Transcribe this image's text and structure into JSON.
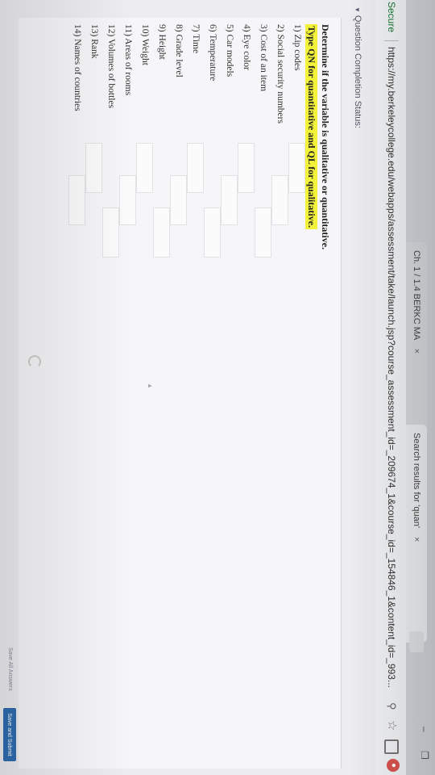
{
  "browser": {
    "tabs": [
      {
        "label": "Ch. 1 / 1.4 BERKC MA",
        "close": "×"
      },
      {
        "label": "Search results for 'quan'",
        "close": "×"
      }
    ],
    "secure_label": "Secure",
    "url": "https://my.berkeleycollege.edu/webapps/assessment/take/launch.jsp?course_assessment_id=_209674_1&course_id=_154846_1&content_id=_993..."
  },
  "page": {
    "completion_status": "Question Completion Status:",
    "instruction_line1": "Determine if the variable is qualitative or quantitative.",
    "instruction_line2": "Type QN for quantitative and QL for qualitative.",
    "items": [
      {
        "label": "1) Zip codes"
      },
      {
        "label": "2) Social security numbers"
      },
      {
        "label": "3) Cost of an item"
      },
      {
        "label": "4) Eye color"
      },
      {
        "label": "5) Car models"
      },
      {
        "label": "6) Temperature"
      },
      {
        "label": "7) Time"
      },
      {
        "label": "8) Grade level"
      },
      {
        "label": "9) Height"
      },
      {
        "label": "10) Weight"
      },
      {
        "label": "11) Areas of rooms"
      },
      {
        "label": "12) Volumes of bottles"
      },
      {
        "label": "13) Rank"
      },
      {
        "label": "14) Names of countries"
      }
    ],
    "save_all_label": "Save All Answers",
    "submit_label": "Save and Submit"
  },
  "colors": {
    "highlight": "#f2f23a",
    "secure_green": "#1a7a35",
    "submit_blue": "#2e6db0"
  }
}
